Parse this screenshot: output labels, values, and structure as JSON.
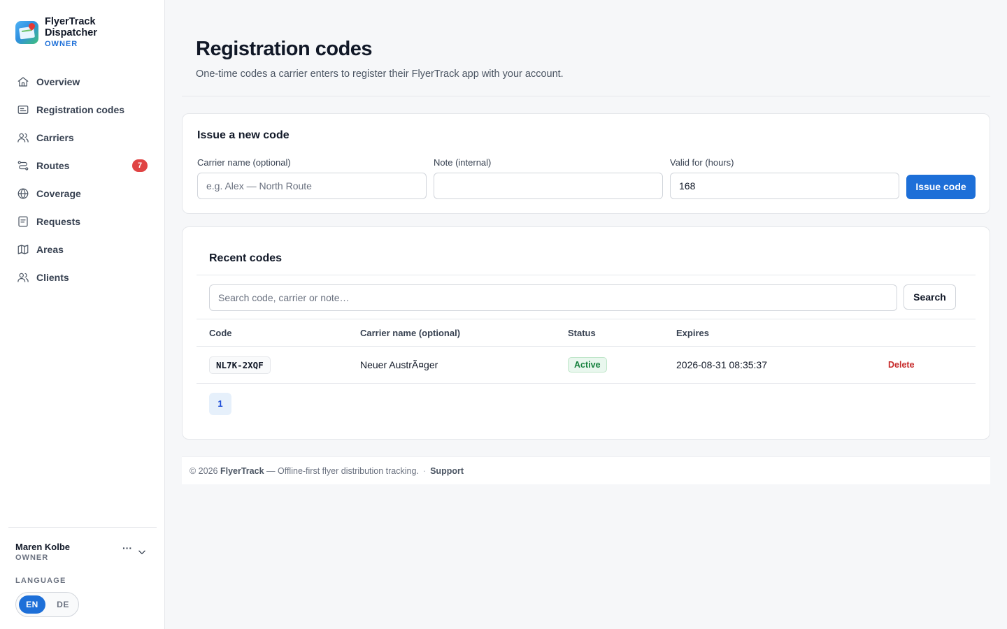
{
  "brand": {
    "name_line1": "FlyerTrack",
    "name_line2": "Dispatcher",
    "role": "OWNER"
  },
  "nav": {
    "items": [
      {
        "label": "Overview",
        "icon": "home-icon"
      },
      {
        "label": "Registration codes",
        "icon": "list-icon"
      },
      {
        "label": "Carriers",
        "icon": "users-icon"
      },
      {
        "label": "Routes",
        "icon": "route-icon",
        "badge": "7"
      },
      {
        "label": "Coverage",
        "icon": "globe-icon"
      },
      {
        "label": "Requests",
        "icon": "document-icon"
      },
      {
        "label": "Areas",
        "icon": "map-icon"
      },
      {
        "label": "Clients",
        "icon": "users-icon"
      }
    ]
  },
  "user": {
    "name": "Maren Kolbe",
    "role": "OWNER",
    "more": "···"
  },
  "language": {
    "label": "LANGUAGE",
    "options": [
      "EN",
      "DE"
    ],
    "selected": "EN"
  },
  "page": {
    "title": "Registration codes",
    "subtitle": "One-time codes a carrier enters to register their FlyerTrack app with your account."
  },
  "issue": {
    "title": "Issue a new code",
    "carrier_label": "Carrier name (optional)",
    "carrier_placeholder": "e.g. Alex — North Route",
    "note_label": "Note (internal)",
    "note_value": "",
    "valid_label": "Valid for (hours)",
    "valid_value": "168",
    "button": "Issue code"
  },
  "recent": {
    "title": "Recent codes",
    "search_placeholder": "Search code, carrier or note…",
    "search_button": "Search",
    "columns": [
      "Code",
      "Carrier name (optional)",
      "Status",
      "Expires"
    ],
    "rows": [
      {
        "code": "NL7K-2XQF",
        "carrier": "Neuer AustrÃ¤ger",
        "status": "Active",
        "expires": "2026-08-31 08:35:37",
        "action": "Delete"
      }
    ],
    "pages": [
      "1"
    ]
  },
  "footer": {
    "prefix": "© 2026",
    "brand": "FlyerTrack",
    "text": "— Offline-first flyer distribution tracking.",
    "sep": "·",
    "link": "Support"
  },
  "colors": {
    "accent": "#1d6fd8",
    "badge": "#e04444",
    "active": "#15803d",
    "danger": "#c62828"
  }
}
